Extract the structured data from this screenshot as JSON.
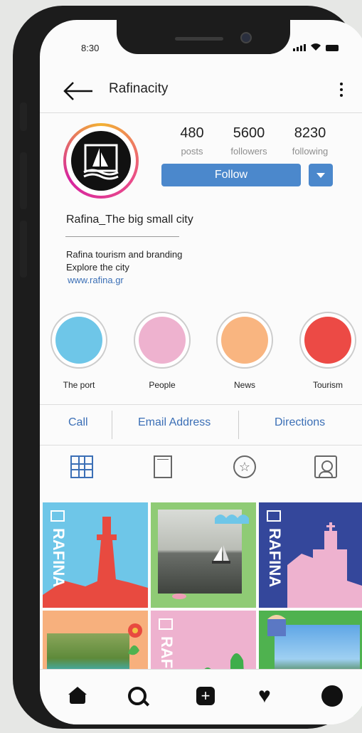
{
  "status_bar": {
    "time": "8:30"
  },
  "header": {
    "username": "Rafinacity"
  },
  "stats": [
    {
      "num": "480",
      "label": "posts"
    },
    {
      "num": "5600",
      "label": "followers"
    },
    {
      "num": "8230",
      "label": "following"
    }
  ],
  "actions": {
    "follow": "Follow"
  },
  "profile": {
    "display_name": "Rafina_The big small city",
    "bio_line1": "Rafina tourism and branding",
    "bio_line2": "Explore the city",
    "link": "www.rafina.gr",
    "logo_text": ""
  },
  "highlights": [
    {
      "label": "The port",
      "color": "#6ec6e8"
    },
    {
      "label": "People",
      "color": "#eeb2cf"
    },
    {
      "label": "News",
      "color": "#f9b580"
    },
    {
      "label": "Tourism",
      "color": "#ec4a45"
    }
  ],
  "contact": {
    "call": "Call",
    "email": "Email Address",
    "directions": "Directions"
  },
  "colors": {
    "accent": "#4b88cc",
    "link": "#3b6fb6"
  },
  "posts": [
    {
      "text": "RAFINA"
    },
    {
      "text": ""
    },
    {
      "text": "RAFINA"
    },
    {
      "text": ""
    },
    {
      "text": "RAFINA"
    },
    {
      "text": ""
    }
  ]
}
